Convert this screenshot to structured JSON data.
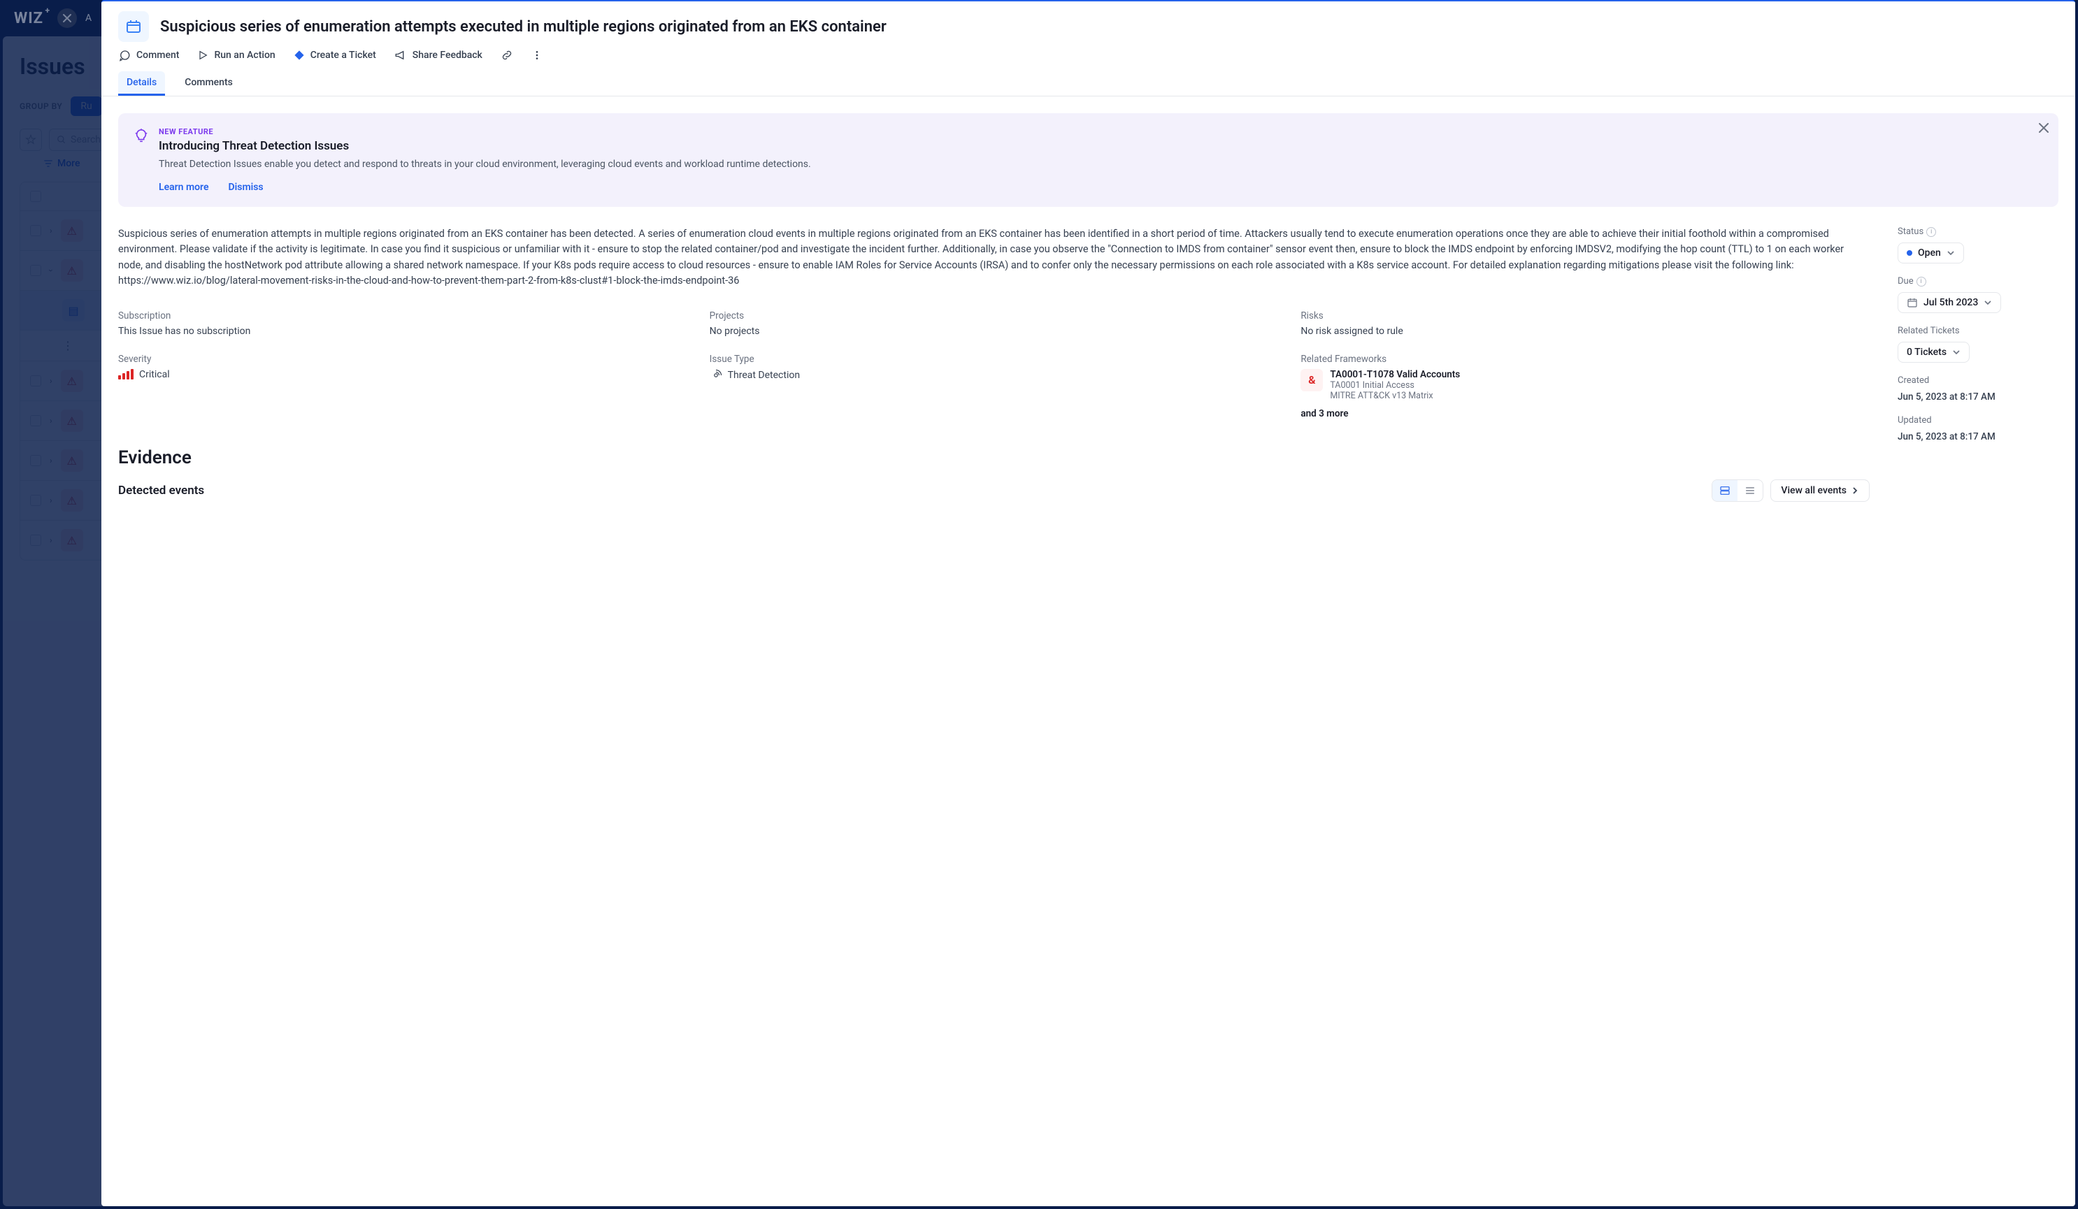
{
  "background": {
    "logo": "WIZ",
    "title": "Issues",
    "groupByLabel": "GROUP BY",
    "groupByValue": "Ru",
    "searchPlaceholder": "Search",
    "moreFilters": "More"
  },
  "panel": {
    "title": "Suspicious series of enumeration attempts executed in multiple regions originated from an EKS container",
    "actions": {
      "comment": "Comment",
      "runAction": "Run an Action",
      "ticket": "Create a Ticket",
      "feedback": "Share Feedback"
    },
    "tabs": {
      "details": "Details",
      "comments": "Comments"
    }
  },
  "banner": {
    "badge": "NEW FEATURE",
    "title": "Introducing Threat Detection Issues",
    "text": "Threat Detection Issues enable you detect and respond to threats in your cloud environment, leveraging cloud events and workload runtime detections.",
    "learnMore": "Learn more",
    "dismiss": "Dismiss"
  },
  "description": "Suspicious series of enumeration attempts in multiple regions originated from an EKS container has been detected. A series of enumeration cloud events in multiple regions originated from an EKS container has been identified in a short period of time. Attackers usually tend to execute enumeration operations once they are able to achieve their initial foothold within a compromised environment. Please validate if the activity is legitimate. In case you find it suspicious or unfamiliar with it - ensure to stop the related container/pod and investigate the incident further. Additionally, in case you observe the \"Connection to IMDS from container\" sensor event then, ensure to block the IMDS endpoint by enforcing IMDSV2, modifying the hop count (TTL) to 1 on each worker node, and disabling the hostNetwork pod attribute allowing a shared network namespace. If your K8s pods require access to cloud resources - ensure to enable IAM Roles for Service Accounts (IRSA) and to confer only the necessary permissions on each role associated with a K8s service account. For detailed explanation regarding mitigations please visit the following link: https://www.wiz.io/blog/lateral-movement-risks-in-the-cloud-and-how-to-prevent-them-part-2-from-k8s-clust#1-block-the-imds-endpoint-36",
  "meta": {
    "subscriptionLabel": "Subscription",
    "subscriptionValue": "This Issue has no subscription",
    "projectsLabel": "Projects",
    "projectsValue": "No projects",
    "risksLabel": "Risks",
    "risksValue": "No risk assigned to rule",
    "severityLabel": "Severity",
    "severityValue": "Critical",
    "issueTypeLabel": "Issue Type",
    "issueTypeValue": "Threat Detection",
    "frameworksLabel": "Related Frameworks",
    "framework": {
      "title": "TA0001-T1078 Valid Accounts",
      "sub1": "TA0001 Initial Access",
      "sub2": "MITRE ATT&CK v13 Matrix"
    },
    "frameworkMore": "and 3 more"
  },
  "side": {
    "statusLabel": "Status",
    "statusValue": "Open",
    "dueLabel": "Due",
    "dueValue": "Jul 5th 2023",
    "ticketsLabel": "Related Tickets",
    "ticketsValue": "0 Tickets",
    "createdLabel": "Created",
    "createdValue": "Jun 5, 2023 at 8:17 AM",
    "updatedLabel": "Updated",
    "updatedValue": "Jun 5, 2023 at 8:17 AM"
  },
  "evidence": {
    "title": "Evidence",
    "detected": "Detected events",
    "viewAll": "View all events"
  }
}
